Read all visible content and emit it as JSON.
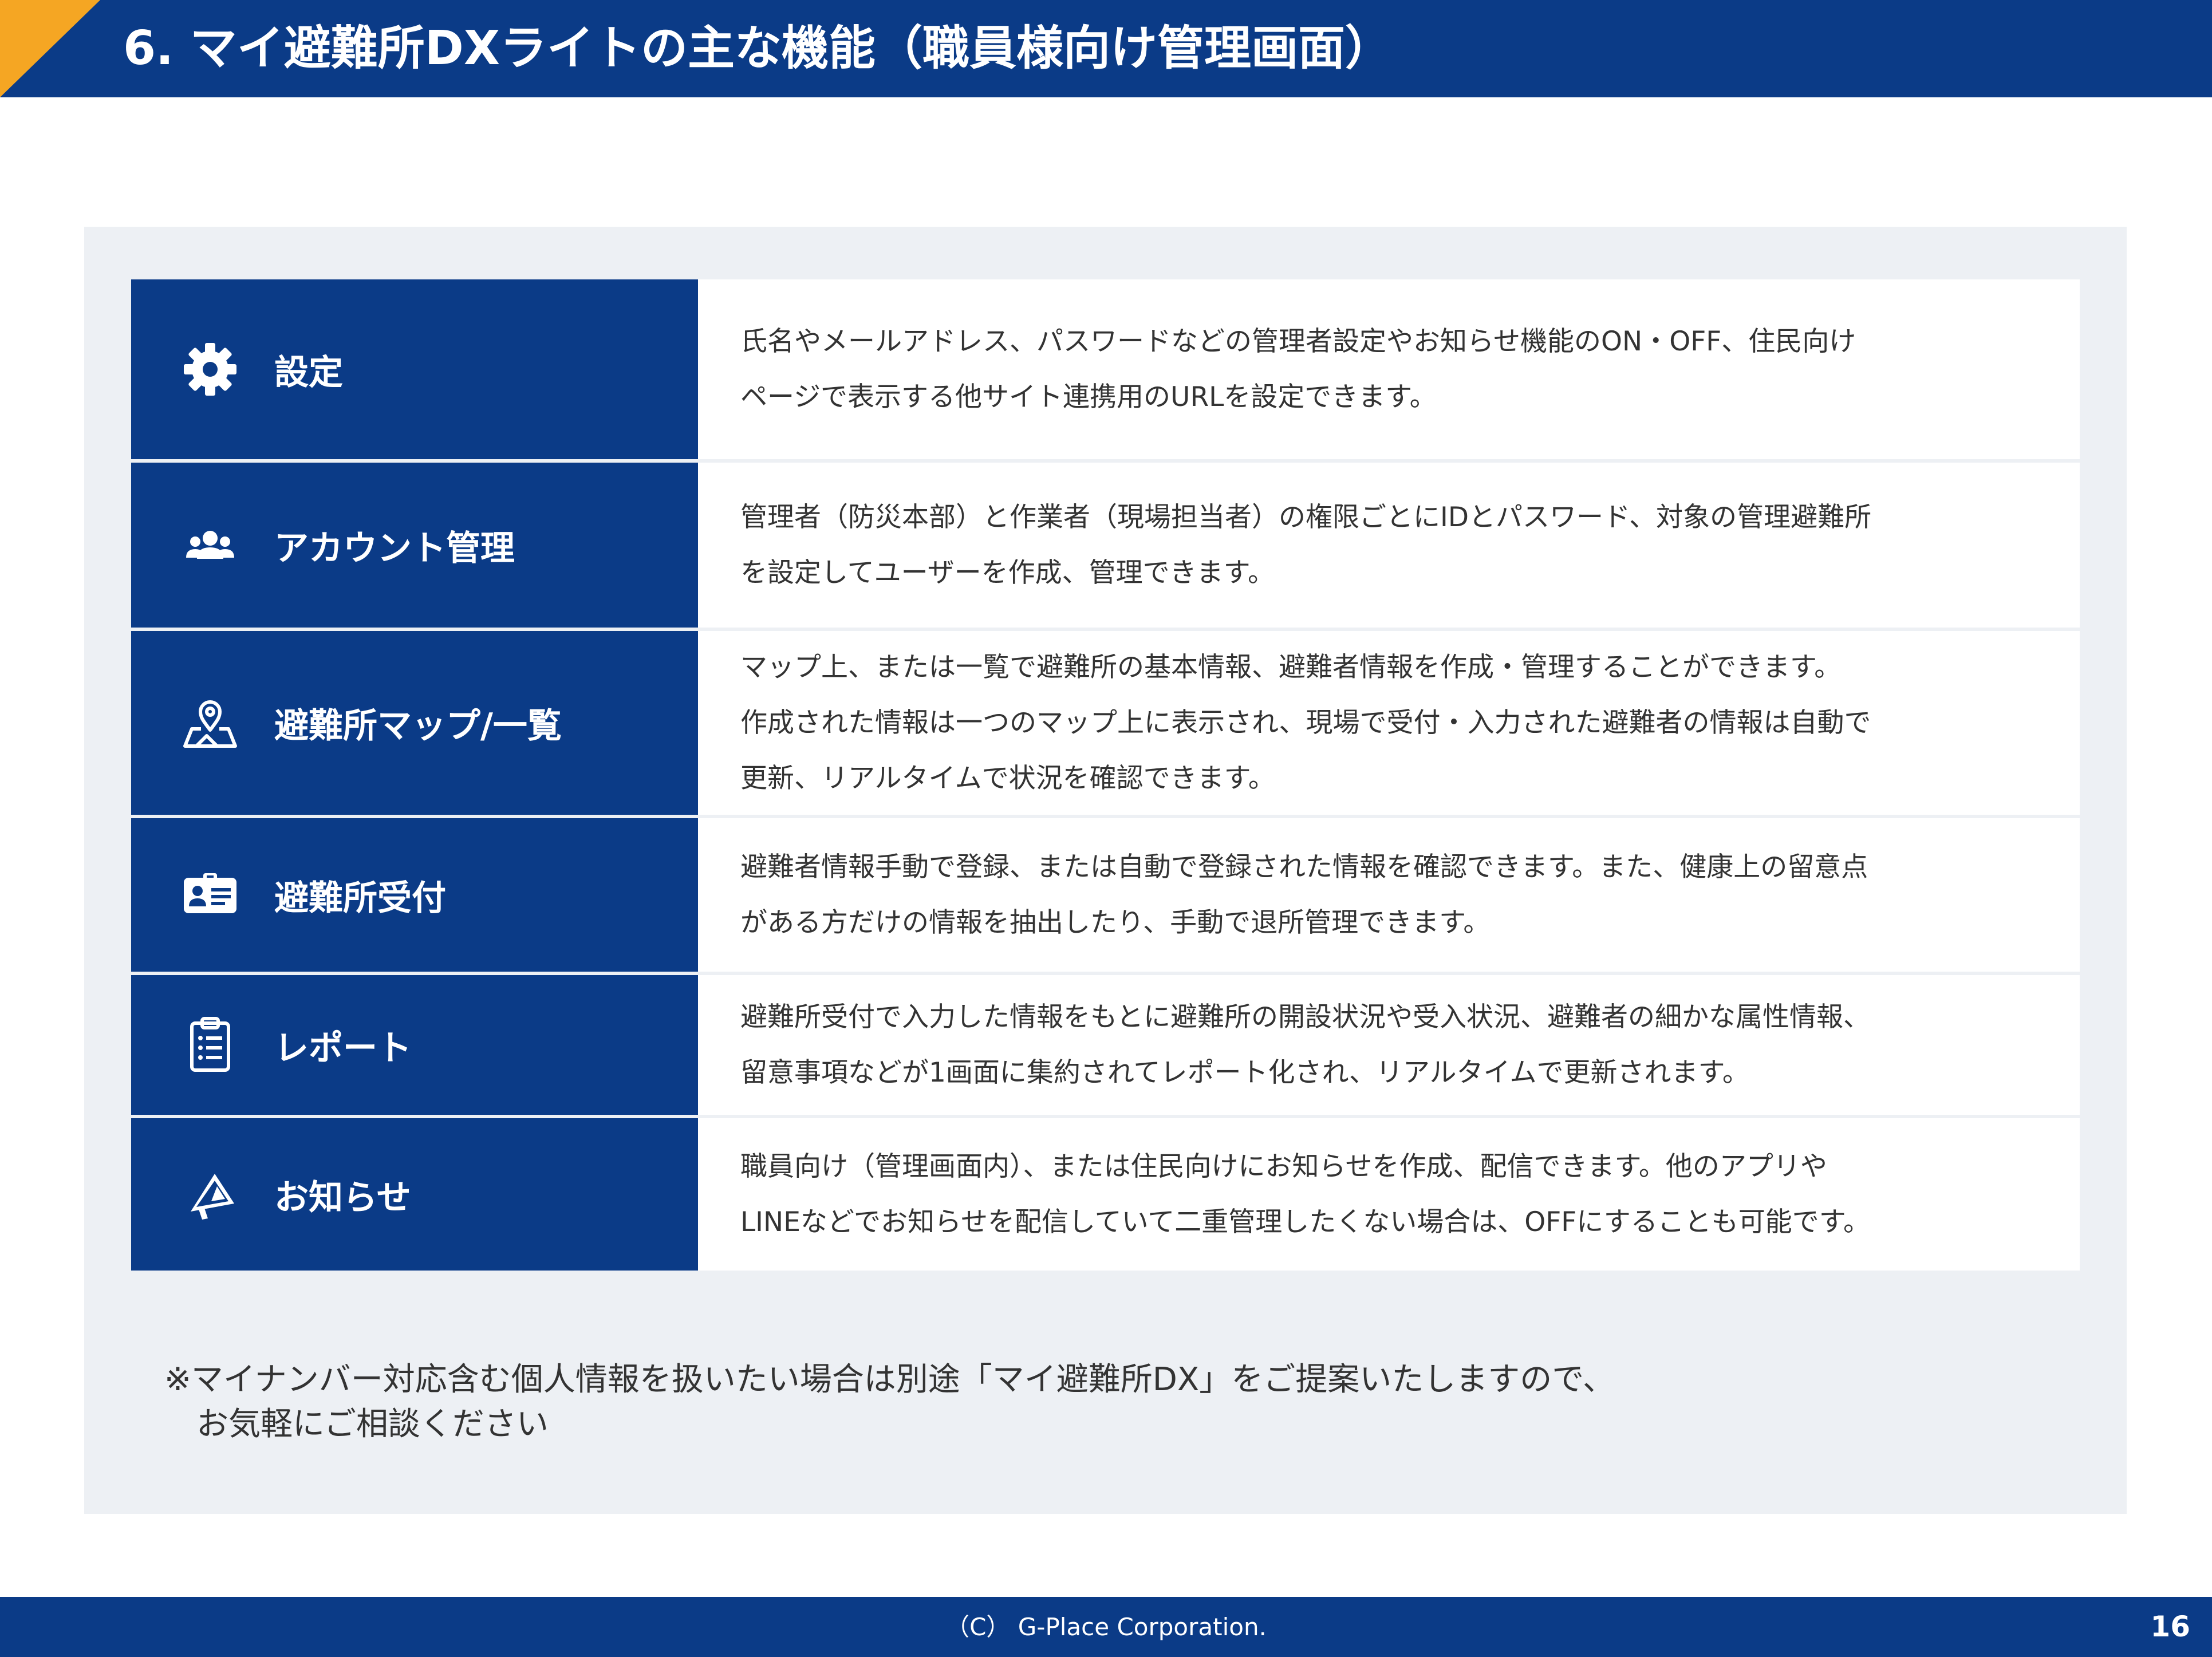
{
  "header": {
    "title": "6. マイ避難所DXライトの主な機能（職員様向け管理画面）"
  },
  "features": [
    {
      "icon": "gear-icon",
      "label": "設定",
      "description": "氏名やメールアドレス、パスワードなどの管理者設定やお知らせ機能のON・OFF、住民向け\nページで表示する他サイト連携用のURLを設定できます。"
    },
    {
      "icon": "users-icon",
      "label": "アカウント管理",
      "description": "管理者（防災本部）と作業者（現場担当者）の権限ごとにIDとパスワード、対象の管理避難所\nを設定してユーザーを作成、管理できます。"
    },
    {
      "icon": "map-pin-icon",
      "label": "避難所マップ/一覧",
      "description": "マップ上、または一覧で避難所の基本情報、避難者情報を作成・管理することができます。\n作成された情報は一つのマップ上に表示され、現場で受付・入力された避難者の情報は自動で\n更新、リアルタイムで状況を確認できます。"
    },
    {
      "icon": "id-card-icon",
      "label": "避難所受付",
      "description": "避難者情報手動で登録、または自動で登録された情報を確認できます。また、健康上の留意点\nがある方だけの情報を抽出したり、手動で退所管理できます。"
    },
    {
      "icon": "clipboard-icon",
      "label": "レポート",
      "description": "避難所受付で入力した情報をもとに避難所の開設状況や受入状況、避難者の細かな属性情報、\n留意事項などが1画面に集約されてレポート化され、リアルタイムで更新されます。"
    },
    {
      "icon": "megaphone-icon",
      "label": "お知らせ",
      "description": "職員向け（管理画面内）、または住民向けにお知らせを作成、配信できます。他のアプリや\nLINEなどでお知らせを配信していて二重管理したくない場合は、OFFにすることも可能です。"
    }
  ],
  "note": "※マイナンバー対応含む個人情報を扱いたい場合は別途「マイ避難所DX」をご提案いたしますので、\n　お気軽にご相談ください",
  "footer": {
    "copyright": "（C） G-Place Corporation.",
    "page_number": "16"
  },
  "colors": {
    "brand_navy": "#0b3b87",
    "accent_orange": "#f5a623",
    "panel_bg": "#edf0f4"
  }
}
